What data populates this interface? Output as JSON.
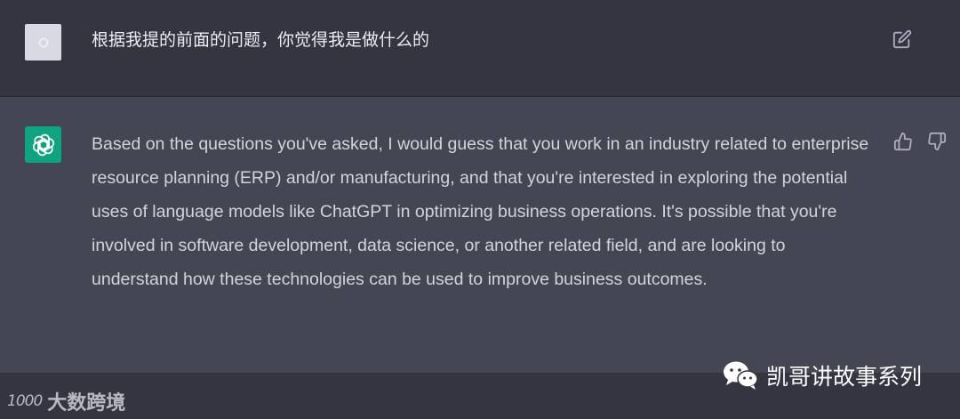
{
  "conversation": {
    "user_message": {
      "avatar_icon": "user-avatar-icon",
      "text": "根据我提的前面的问题，你觉得我是做什么的",
      "edit_icon": "edit-icon"
    },
    "assistant_message": {
      "avatar_icon": "openai-logo-icon",
      "avatar_color": "#10a37f",
      "text": "Based on the questions you've asked, I would guess that you work in an industry related to enterprise resource planning (ERP) and/or manufacturing, and that you're interested in exploring the potential uses of language models like ChatGPT in optimizing business operations. It's possible that you're involved in software development, data science, or another related field, and are looking to understand how these technologies can be used to improve business outcomes.",
      "thumbs_up_icon": "thumbs-up-icon",
      "thumbs_down_icon": "thumbs-down-icon"
    }
  },
  "watermarks": {
    "left": {
      "logo_text": "1000",
      "text": "大数跨境"
    },
    "right": {
      "icon": "wechat-icon",
      "text": "凯哥讲故事系列"
    }
  },
  "colors": {
    "background": "#343541",
    "assistant_background": "#444654",
    "accent": "#10a37f"
  }
}
